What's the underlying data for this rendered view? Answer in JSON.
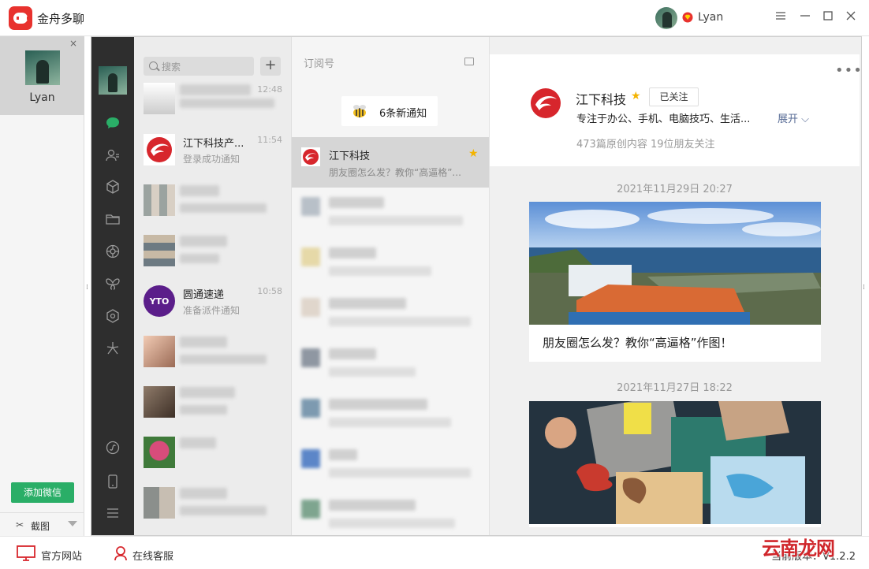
{
  "titlebar": {
    "app_title": "金舟多聊",
    "user_name": "Lyan",
    "menu_icon": "hamburger-icon",
    "minimize_icon": "minimize-icon",
    "maximize_icon": "maximize-icon",
    "close_icon": "close-icon"
  },
  "accounts": {
    "items": [
      {
        "name": "Lyan",
        "close": "×"
      }
    ],
    "add_button": "添加微信",
    "screenshot_label": "截图"
  },
  "wechat_nav": {
    "icons": [
      "chat-icon",
      "contacts-icon",
      "box-icon",
      "folder-icon",
      "aperture-icon",
      "butterfly-icon",
      "hexagon-flower-icon",
      "sparkle-icon",
      "miniprogram-icon",
      "phone-icon",
      "menu-icon"
    ]
  },
  "chat_list": {
    "search_placeholder": "搜索",
    "add": "+",
    "items": [
      {
        "name": "",
        "sub": "",
        "time": "12:48",
        "blurred": true
      },
      {
        "name": "江下科技产...",
        "sub": "登录成功通知",
        "time": "11:54",
        "blurred": false
      },
      {
        "name": "",
        "sub": "",
        "time": "",
        "blurred": true
      },
      {
        "name": "",
        "sub": "",
        "time": "",
        "blurred": true
      },
      {
        "name": "圆通速递",
        "sub": "准备派件通知",
        "time": "10:58",
        "blurred": false
      },
      {
        "name": "",
        "sub": "",
        "time": "",
        "blurred": true
      },
      {
        "name": "",
        "sub": "",
        "time": "",
        "blurred": true
      },
      {
        "name": "",
        "sub": "",
        "time": "",
        "blurred": true
      },
      {
        "name": "",
        "sub": "",
        "time": "",
        "blurred": true
      }
    ]
  },
  "subscriptions": {
    "header": "订阅号",
    "notice": "6条新通知",
    "active": {
      "name": "江下科技",
      "desc": "朋友圈怎么发？教你“高逼格”..."
    }
  },
  "article_pane": {
    "profile": {
      "name": "江下科技",
      "follow_badge": "已关注",
      "desc": "专注于办公、手机、电脑技巧、生活...",
      "expand": "展开",
      "stats": "473篇原创内容   19位朋友关注"
    },
    "articles": [
      {
        "date": "2021年11月29日 20:27",
        "title": "朋友圈怎么发？教你“高逼格”作图！"
      },
      {
        "date": "2021年11月27日 18:22",
        "title": ""
      }
    ]
  },
  "footer": {
    "website": "官方网站",
    "support": "在线客服",
    "version": "当前版本：V1.2.2"
  },
  "watermark": "云南龙网",
  "colors": {
    "brand_red": "#e8322e",
    "wechat_green": "#2aae67",
    "star": "#f3b300",
    "link": "#576b95"
  }
}
